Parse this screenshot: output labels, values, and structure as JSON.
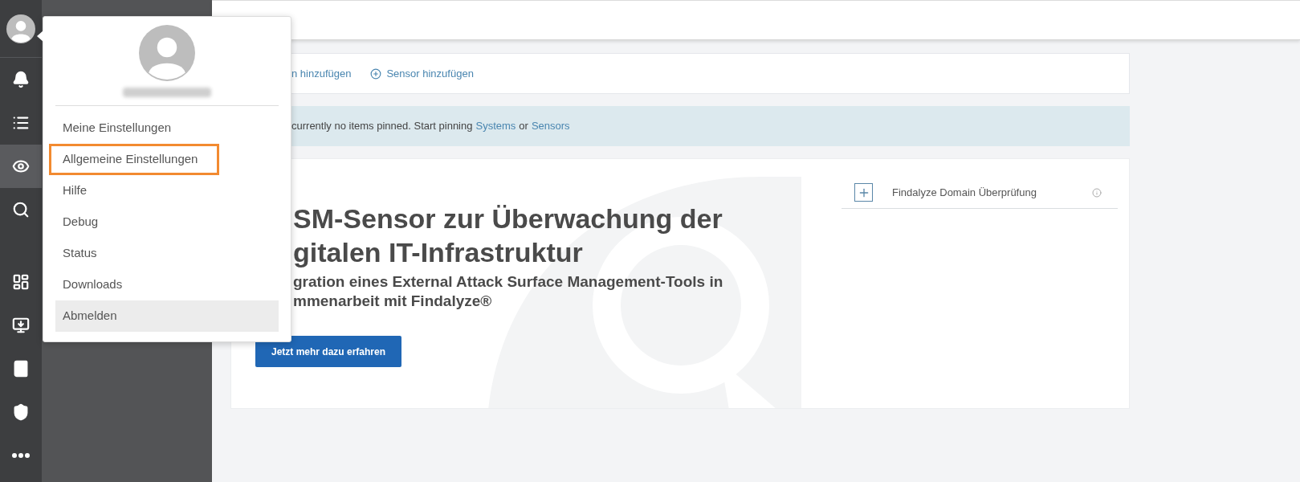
{
  "sidebar": {
    "items": [
      {
        "selected": false
      },
      {
        "selected": false
      },
      {
        "selected": true
      },
      {
        "selected": false
      },
      {
        "selected": false
      },
      {
        "selected": false
      },
      {
        "selected": false
      },
      {
        "selected": false
      },
      {
        "selected": false
      }
    ]
  },
  "user_menu": {
    "items": [
      {
        "label": "Meine Einstellungen",
        "highlighted": false,
        "hovered": false
      },
      {
        "label": "Allgemeine Einstellungen",
        "highlighted": true,
        "hovered": false
      },
      {
        "label": "Hilfe",
        "highlighted": false,
        "hovered": false
      },
      {
        "label": "Debug",
        "highlighted": false,
        "hovered": false
      },
      {
        "label": "Status",
        "highlighted": false,
        "hovered": false
      },
      {
        "label": "Downloads",
        "highlighted": false,
        "hovered": false
      },
      {
        "label": "Abmelden",
        "highlighted": false,
        "hovered": true
      }
    ]
  },
  "actions": [
    {
      "label": "n hinzufügen",
      "icon": false
    },
    {
      "label": "Sensor hinzufügen",
      "icon": true
    }
  ],
  "info_banner": {
    "text": "currently no items pinned. Start pinning",
    "link_1": "Systems",
    "joiner": "or",
    "link_2": "Sensors"
  },
  "promo": {
    "title_lines": [
      "SM-Sensor zur Überwachung der",
      "gitalen IT-Infrastruktur"
    ],
    "subtitle_lines": [
      "gration eines External Attack Surface Management-Tools in",
      "mmenarbeit mit Findalyze®"
    ],
    "button": "Jetzt mehr dazu erfahren"
  },
  "widget": {
    "label": "Findalyze Domain Überprüfung"
  }
}
